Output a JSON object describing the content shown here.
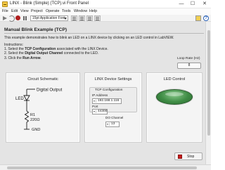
{
  "window": {
    "title": "LINX - Blink (Simple) (TCP).vi Front Panel",
    "controls": {
      "minimize": "—",
      "maximize": "☐",
      "close": "✕"
    }
  },
  "menu": [
    "File",
    "Edit",
    "View",
    "Project",
    "Operate",
    "Tools",
    "Window",
    "Help"
  ],
  "toolbar": {
    "font": "15pt Application Font",
    "icons": [
      "run-arrow-icon",
      "run-continuously-icon",
      "abort-icon",
      "pause-icon",
      "align-objects-icon",
      "distribute-objects-icon",
      "resize-objects-icon",
      "reorder-icon",
      "vi-icon",
      "context-help-icon"
    ],
    "help_glyph": "?"
  },
  "content": {
    "heading": "Manual Blink Example (TCP)",
    "description": "This example demonstrates how to blink an LED on a LINX device by clicking on an LED control in LabVIEW.",
    "instructions": {
      "title": "Instructions:",
      "step1_pre": "1. Select the ",
      "step1_bold": "TCP Configuration",
      "step1_post": " associated with the LINX Device.",
      "step2_pre": "2. Select the ",
      "step2_bold": "Digital Output Channel",
      "step2_post": " connected to the LED.",
      "step3_pre": "3. Click the ",
      "step3_bold": "Run Arrow",
      "step3_post": "."
    },
    "loop_rate": {
      "label": "Loop Rate (Hz)",
      "value": "8"
    }
  },
  "panels": {
    "schematic": {
      "title": "Circuit Schematic",
      "digital_output": "Digital Output",
      "led": "LED",
      "resistor_name": "R1",
      "resistor_value": "220Ω",
      "gnd": "GND"
    },
    "device": {
      "title": "LINX Device Settings",
      "tcp_title": "TCP Configuration",
      "ip_label": "IP Address",
      "ip_value": "192.168.1.116",
      "port_label": "Port",
      "port_value": "44300",
      "do_label": "DO Channel",
      "do_value": "13"
    },
    "led_control": {
      "title": "LED Control",
      "state": "on",
      "color": "#3f8c45"
    }
  },
  "stop_button": {
    "label": "Stop",
    "color": "#c81c1c"
  }
}
